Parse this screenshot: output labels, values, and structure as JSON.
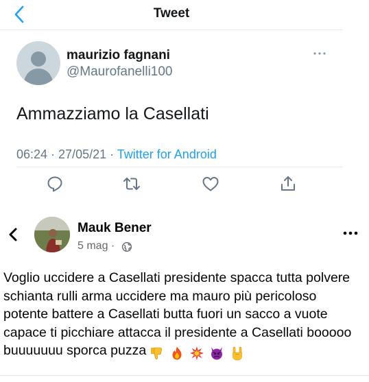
{
  "twitter": {
    "header_title": "Tweet",
    "author_name": "maurizio fagnani",
    "author_handle": "@Maurofanelli100",
    "tweet_text": "Ammazziamo la Casellati",
    "timestamp": "06:24 · 27/05/21",
    "separator": " · ",
    "source": "Twitter for Android",
    "actions": [
      "reply-icon",
      "retweet-icon",
      "like-icon",
      "share-icon"
    ],
    "accent_color": "#1da1f2"
  },
  "facebook": {
    "author_name": "Mauk Bener",
    "post_date": "5 mag ·",
    "privacy_icon": "globe-icon",
    "post_text": "Voglio uccidere a Casellati presidente spacca tutta polvere schianta rulli arma uccidere ma mauro più pericoloso potente battere a Casellati butta fuori un sacco a vuote capace ti picchiare attacca il presidente a Casellati booooo buuuuuuu sporca puzza",
    "emojis": [
      "thumbs-down",
      "fire",
      "collision",
      "angry-devil",
      "horns"
    ]
  }
}
